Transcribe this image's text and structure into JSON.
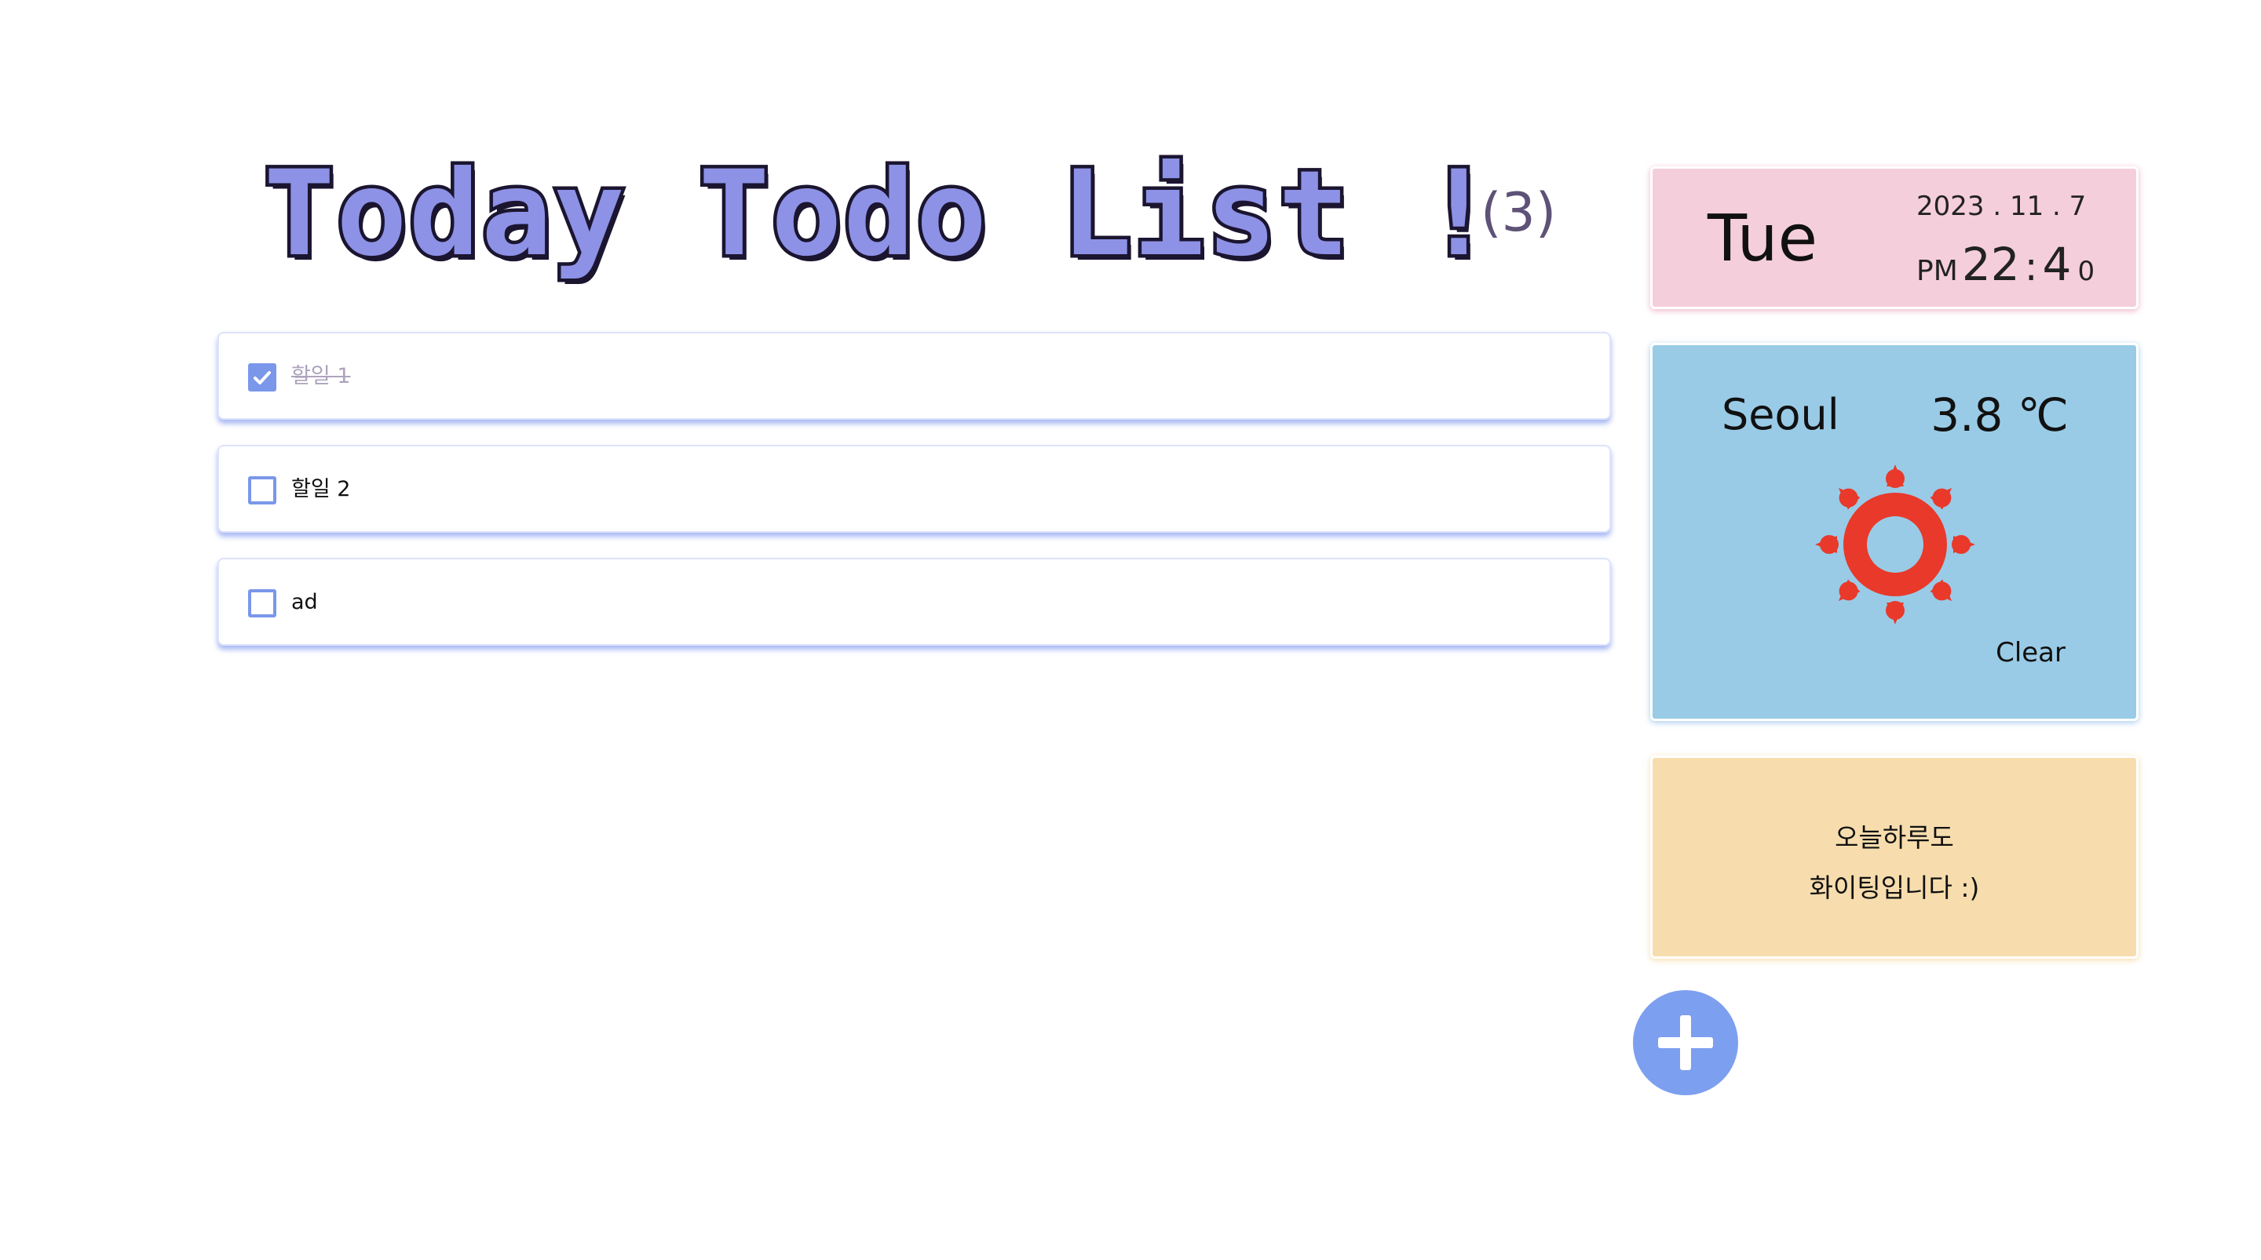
{
  "header": {
    "title": "Today Todo List !",
    "count": "(3)"
  },
  "todos": [
    {
      "label": "할일 1",
      "checked": true
    },
    {
      "label": "할일 2",
      "checked": false
    },
    {
      "label": "ad",
      "checked": false
    }
  ],
  "date_card": {
    "day": "Tue",
    "date": "2023 . 11 . 7",
    "ampm": "PM",
    "hour": "22",
    "separator": ":",
    "minute": "4",
    "second": "0"
  },
  "weather": {
    "city": "Seoul",
    "temperature": "3.8 ℃",
    "description": "Clear",
    "icon": "sun-icon"
  },
  "quote": {
    "line1": "오늘하루도",
    "line2": "화이팅입니다 :)"
  },
  "add_button": {
    "icon": "plus-icon"
  },
  "colors": {
    "accent": "#7d9ff0",
    "date_card_bg": "#f5cedb",
    "weather_card_bg": "#99cbe6",
    "quote_card_bg": "#f7ddad",
    "sun": "#e8392a",
    "title_fill": "#8d92e6"
  }
}
